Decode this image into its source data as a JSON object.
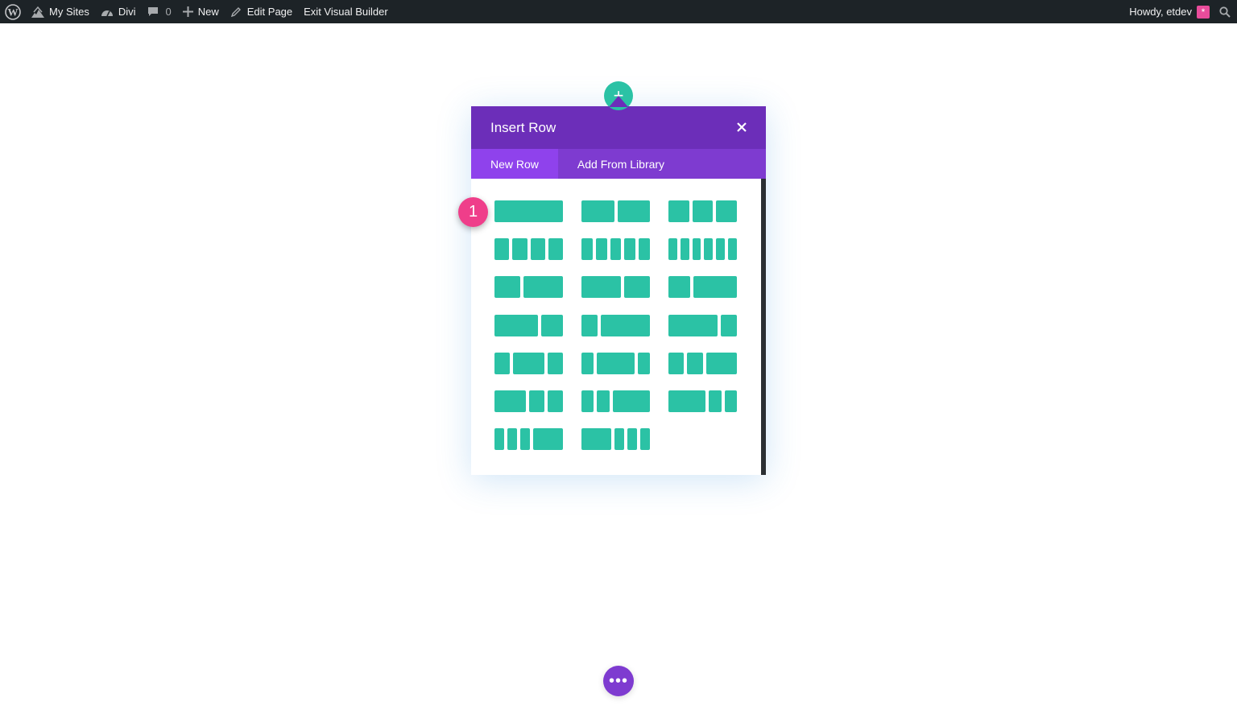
{
  "admin_bar": {
    "wp_logo_icon": "wordpress-logo-icon",
    "my_sites": "My Sites",
    "site_name": "Divi",
    "comments_count": "0",
    "new": "New",
    "edit_page": "Edit Page",
    "exit_builder": "Exit Visual Builder",
    "howdy": "Howdy, etdev",
    "avatar_glyph": "*"
  },
  "modal": {
    "title": "Insert Row",
    "tabs": [
      {
        "label": "New Row",
        "active": true
      },
      {
        "label": "Add From Library",
        "active": false
      }
    ]
  },
  "layouts": [
    {
      "name": "1 column",
      "columns": [
        1
      ]
    },
    {
      "name": "1/2 + 1/2",
      "columns": [
        1,
        1
      ]
    },
    {
      "name": "1/3 + 1/3 + 1/3",
      "columns": [
        1,
        1,
        1
      ]
    },
    {
      "name": "4 columns",
      "columns": [
        1,
        1,
        1,
        1
      ]
    },
    {
      "name": "5 columns",
      "columns": [
        1,
        1,
        1,
        1,
        1
      ]
    },
    {
      "name": "6 columns",
      "columns": [
        1,
        1,
        1,
        1,
        1,
        1
      ]
    },
    {
      "name": "2/5 + 3/5",
      "columns": [
        2,
        3
      ]
    },
    {
      "name": "3/5 + 2/5",
      "columns": [
        3,
        2
      ]
    },
    {
      "name": "1/3 + 2/3",
      "columns": [
        1,
        2
      ]
    },
    {
      "name": "2/3 + 1/3",
      "columns": [
        2,
        1
      ]
    },
    {
      "name": "1/4 + 3/4",
      "columns": [
        1,
        3
      ]
    },
    {
      "name": "3/4 + 1/4",
      "columns": [
        3,
        1
      ]
    },
    {
      "name": "1/4 + 1/2 + 1/4",
      "columns": [
        1,
        2,
        1
      ]
    },
    {
      "name": "1/5 + 3/5 + 1/5",
      "columns": [
        1,
        3,
        1
      ]
    },
    {
      "name": "1/4 + 1/4 + 1/2",
      "columns": [
        1,
        1,
        2
      ]
    },
    {
      "name": "1/2 + 1/4 + 1/4",
      "columns": [
        2,
        1,
        1
      ]
    },
    {
      "name": "1/5 + 1/5 + 3/5",
      "columns": [
        1,
        1,
        3
      ]
    },
    {
      "name": "3/5 + 1/5 + 1/5",
      "columns": [
        3,
        1,
        1
      ]
    },
    {
      "name": "1/6 + 1/6 + 1/6 + 1/2",
      "columns": [
        1,
        1,
        1,
        3
      ]
    },
    {
      "name": "1/2 + 1/6 + 1/6 + 1/6",
      "columns": [
        3,
        1,
        1,
        1
      ]
    }
  ],
  "annotation": {
    "step": "1"
  },
  "buttons": {
    "add_row_glyph": "+",
    "page_settings_glyph": "•••"
  },
  "colors": {
    "admin_bar_bg": "#1d2327",
    "modal_header": "#6c2eb9",
    "tab_bar": "#7e3bd0",
    "tab_active": "#8f42ec",
    "layout_column": "#2bc2a5",
    "step_badge": "#ef3e8a"
  }
}
